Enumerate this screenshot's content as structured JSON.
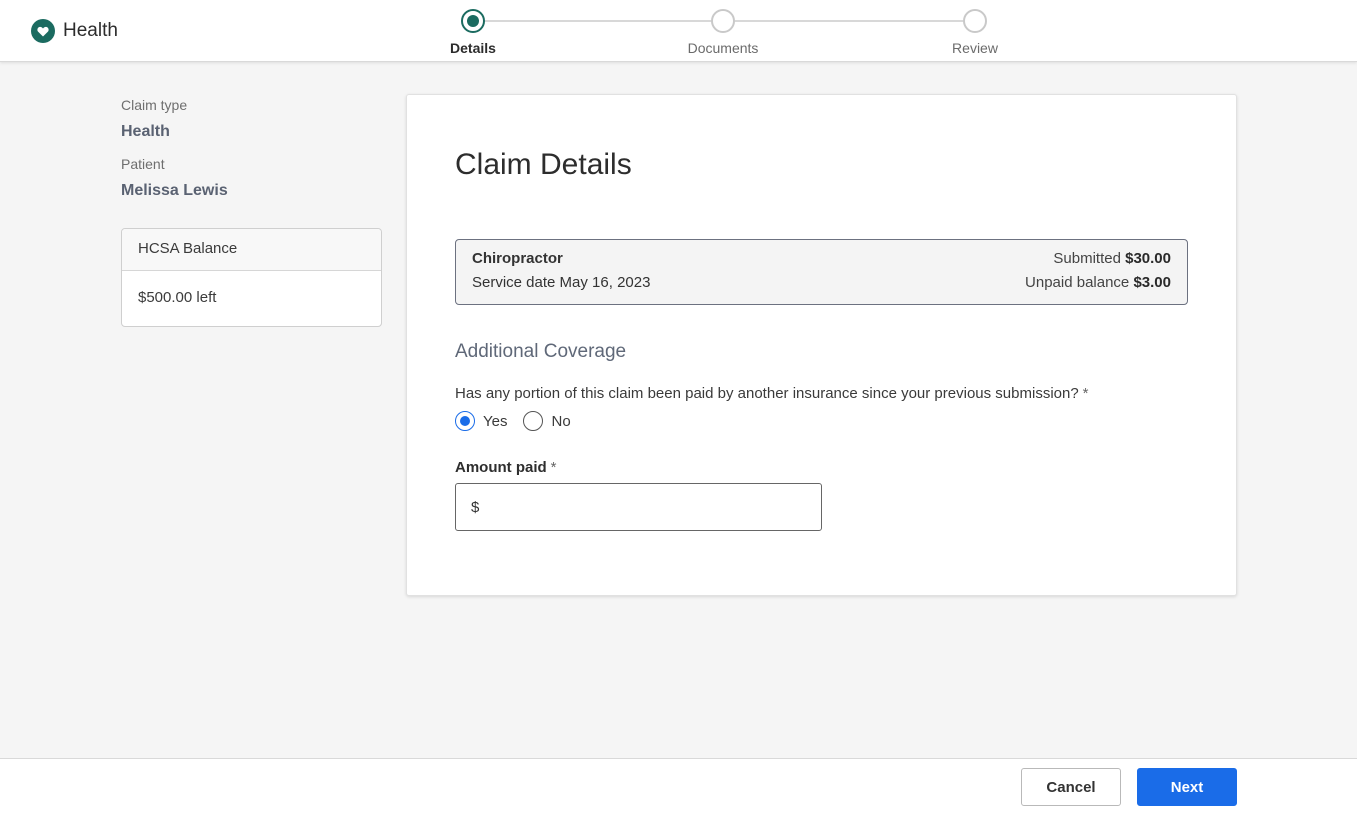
{
  "header": {
    "brand_title": "Health",
    "steps": [
      {
        "label": "Details",
        "state": "active"
      },
      {
        "label": "Documents",
        "state": "pending"
      },
      {
        "label": "Review",
        "state": "pending"
      }
    ]
  },
  "sidebar": {
    "claim_type_label": "Claim type",
    "claim_type_value": "Health",
    "patient_label": "Patient",
    "patient_value": "Melissa Lewis",
    "balance": {
      "title": "HCSA Balance",
      "amount": "$500.00 left"
    }
  },
  "main": {
    "title": "Claim Details",
    "claim": {
      "service": "Chiropractor",
      "service_date": "Service date May 16, 2023",
      "submitted_label": "Submitted",
      "submitted_amount": "$30.00",
      "unpaid_label": "Unpaid balance",
      "unpaid_amount": "$3.00"
    },
    "section_title": "Additional Coverage",
    "question": "Has any portion of this claim been paid by another insurance since your previous submission?",
    "required_mark": "*",
    "options": [
      {
        "label": "Yes",
        "selected": true
      },
      {
        "label": "No",
        "selected": false
      }
    ],
    "amount_label": "Amount paid",
    "amount_prefix": "$",
    "amount_value": ""
  },
  "footer": {
    "cancel_label": "Cancel",
    "next_label": "Next"
  },
  "colors": {
    "brand": "#1b6b60",
    "primary": "#1a6ce8"
  }
}
